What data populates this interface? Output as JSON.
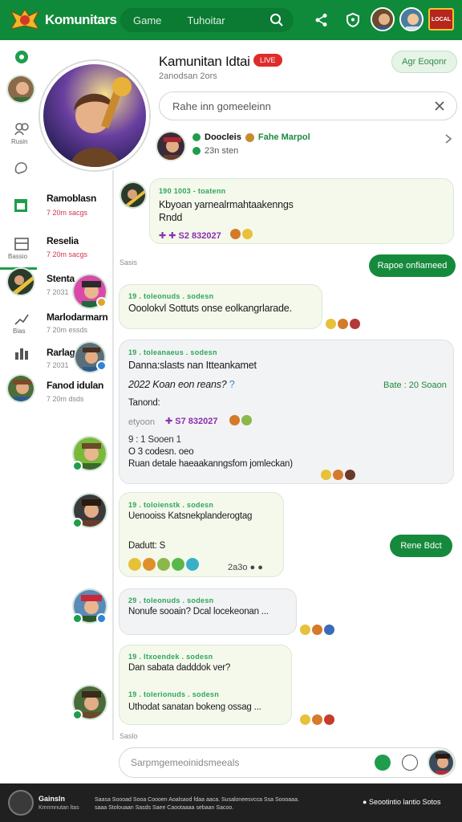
{
  "header": {
    "app_title": "Komunitars",
    "tabs": [
      "Game",
      "Tuhoitar"
    ],
    "badge_text": "LOCAL"
  },
  "rail": {
    "icon_labels": [
      "Rusin",
      "Bassio"
    ],
    "channels": [
      {
        "name": "Ramoblasn",
        "sub": "7 20m sacgs",
        "sub_red": true
      },
      {
        "name": "Reselia",
        "sub": "7 20m sacgs",
        "sub_red": true
      },
      {
        "name": "Stenta",
        "sub": "7 2031"
      },
      {
        "name": "Marlodarmarn",
        "sub": "7 20m essds"
      },
      {
        "name": "Rarlag",
        "sub": "7 2031"
      },
      {
        "name": "Fanod idulan",
        "sub": "7 20m dsds"
      }
    ]
  },
  "profile": {
    "title": "Kamunitan Idtai",
    "live": "LIVE",
    "subtitle": "2anodsan 2ors",
    "join": "Agr Eoqonr",
    "search_placeholder": "Rahe inn gomeeleinn",
    "mod_name": "Doocleis",
    "mod_tag": "Fahe Marpol",
    "mod_line2": "23n sten"
  },
  "chat": {
    "date_label": "Sasis",
    "right_pill_1": "Rapoe onfiameed",
    "right_pill_2": "Rene Bdct",
    "end_label": "Saslo",
    "messages": [
      {
        "meta": "190 1003 - toatenn",
        "line1": "Kbyoan yarnealrmahtaakenngs",
        "line2": "Rndd",
        "purple": "S2 832027"
      },
      {
        "meta": "19 . toleonuds . sodesn",
        "line1": "Ooolokvl Sottuts onse eolkangrlarade."
      },
      {
        "meta": "19 . toleanaeus . sodesn",
        "line1": "Danna:slasts nan Itteankamet",
        "line2": "2022 Koan eon reans?",
        "side": "Bate : 20 Soaon",
        "line3": "Tanond:",
        "sub_label": "etyoon",
        "purple": "S7 832027",
        "grey1": "9 : 1 Sooen 1",
        "line4": "O 3 codesn. oeo",
        "line5": "Ruan detale haeaakanngsfom jomleckan)"
      },
      {
        "meta": "19 . toloienstk . sodesn",
        "line1": "Uenooiss Katsnekplanderogtag",
        "line2": "Dadutt: S",
        "time": "2a3o"
      },
      {
        "meta": "29 . toleonuds . sodesn",
        "line1": "Nonufe sooain? Dcal locekeonan ..."
      },
      {
        "meta": "19 . ltxoendek . sodesn",
        "line1": "Dan sabata dadddok ver?",
        "meta2": "19 . tolerionuds . sodesn",
        "line2": "Uthodat sanatan bokeng ossag ..."
      }
    ]
  },
  "input": {
    "placeholder": "Sarpmgemeoinidsmeeals"
  },
  "footer": {
    "brand": "Gainsln",
    "brand_sub": "Kmnmnutan ltas",
    "text": "Saasa Soooad Sooa Coooen Aoalsaod fdaa aaca. Susaloneesvcca Ssa Soooaaa. saaa Stolouaan Sasds Saee Caootaaaa sebaan Sacoo.",
    "right": "Seootintio lantio Sotos"
  },
  "colors": {
    "brand_green": "#0f8a3a",
    "live_red": "#e02b2b",
    "accent_purple": "#8a2fae"
  }
}
